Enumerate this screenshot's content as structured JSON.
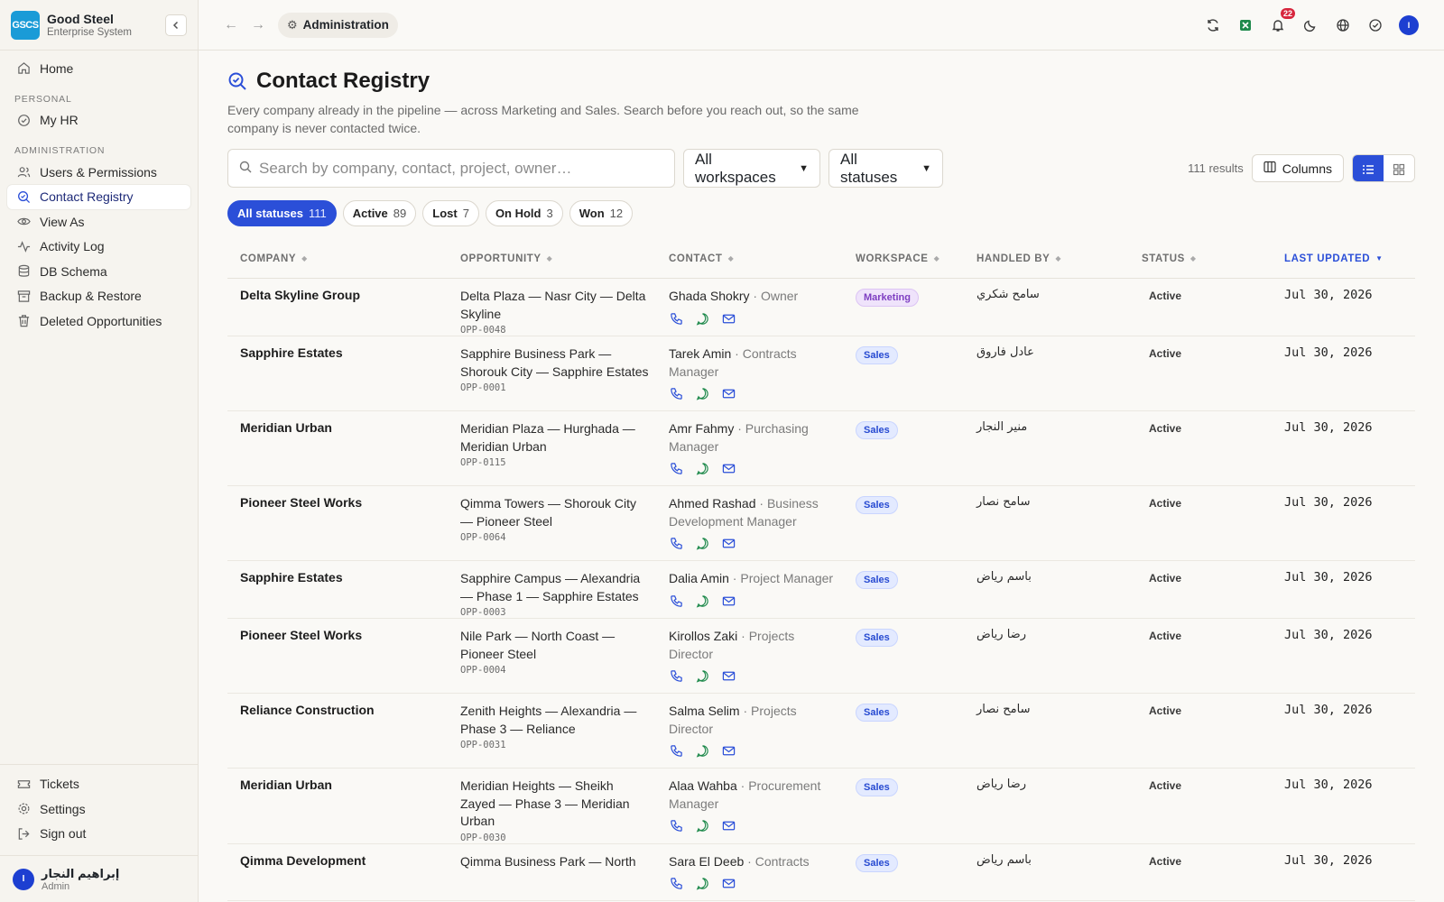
{
  "brand": {
    "logo": "GSCS",
    "name": "Good Steel",
    "subtitle": "Enterprise System",
    "collapse_icon": "chevron-left-icon"
  },
  "sidebar": {
    "home": "Home",
    "section_personal": "PERSONAL",
    "my_hr": "My HR",
    "section_admin": "ADMINISTRATION",
    "items": [
      "Users & Permissions",
      "Contact Registry",
      "View As",
      "Activity Log",
      "DB Schema",
      "Backup & Restore",
      "Deleted Opportunities"
    ],
    "bottom": [
      "Tickets",
      "Settings",
      "Sign out"
    ],
    "user": {
      "initials": "I",
      "name": "إبراهيم النجار",
      "role": "Admin"
    }
  },
  "topbar": {
    "breadcrumb": "Administration",
    "notifications": "22",
    "avatar": "I"
  },
  "page": {
    "title": "Contact Registry",
    "description": "Every company already in the pipeline — across Marketing and Sales. Search before you reach out, so the same company is never contacted twice."
  },
  "filters": {
    "search_placeholder": "Search by company, contact, project, owner…",
    "workspace": "All workspaces",
    "status": "All statuses",
    "results": "111 results",
    "columns_label": "Columns"
  },
  "chips": [
    {
      "label": "All statuses",
      "count": "111"
    },
    {
      "label": "Active",
      "count": "89"
    },
    {
      "label": "Lost",
      "count": "7"
    },
    {
      "label": "On Hold",
      "count": "3"
    },
    {
      "label": "Won",
      "count": "12"
    }
  ],
  "table": {
    "headers": [
      "COMPANY",
      "OPPORTUNITY",
      "CONTACT",
      "WORKSPACE",
      "HANDLED BY",
      "STATUS",
      "LAST UPDATED"
    ],
    "rows": [
      {
        "company": "Delta Skyline Group",
        "opp": "Delta Plaza — Nasr City — Delta Skyline",
        "code": "OPP-0048",
        "contact": "Ghada Shokry",
        "role": "Owner",
        "workspace": "Marketing",
        "handler": "سامح شكري",
        "status": "Active",
        "updated": "Jul 30, 2026"
      },
      {
        "company": "Sapphire Estates",
        "opp": "Sapphire Business Park — Shorouk City — Sapphire Estates",
        "code": "OPP-0001",
        "contact": "Tarek Amin",
        "role": "Contracts Manager",
        "workspace": "Sales",
        "handler": "عادل فاروق",
        "status": "Active",
        "updated": "Jul 30, 2026"
      },
      {
        "company": "Meridian Urban",
        "opp": "Meridian Plaza — Hurghada — Meridian Urban",
        "code": "OPP-0115",
        "contact": "Amr Fahmy",
        "role": "Purchasing Manager",
        "workspace": "Sales",
        "handler": "منير النجار",
        "status": "Active",
        "updated": "Jul 30, 2026"
      },
      {
        "company": "Pioneer Steel Works",
        "opp": "Qimma Towers — Shorouk City — Pioneer Steel",
        "code": "OPP-0064",
        "contact": "Ahmed Rashad",
        "role": "Business Development Manager",
        "workspace": "Sales",
        "handler": "سامح نصار",
        "status": "Active",
        "updated": "Jul 30, 2026"
      },
      {
        "company": "Sapphire Estates",
        "opp": "Sapphire Campus — Alexandria — Phase 1 — Sapphire Estates",
        "code": "OPP-0003",
        "contact": "Dalia Amin",
        "role": "Project Manager",
        "workspace": "Sales",
        "handler": "باسم رياض",
        "status": "Active",
        "updated": "Jul 30, 2026"
      },
      {
        "company": "Pioneer Steel Works",
        "opp": "Nile Park — North Coast — Pioneer Steel",
        "code": "OPP-0004",
        "contact": "Kirollos Zaki",
        "role": "Projects Director",
        "workspace": "Sales",
        "handler": "رضا رياض",
        "status": "Active",
        "updated": "Jul 30, 2026"
      },
      {
        "company": "Reliance Construction",
        "opp": "Zenith Heights — Alexandria — Phase 3 — Reliance",
        "code": "OPP-0031",
        "contact": "Salma Selim",
        "role": "Projects Director",
        "workspace": "Sales",
        "handler": "سامح نصار",
        "status": "Active",
        "updated": "Jul 30, 2026"
      },
      {
        "company": "Meridian Urban",
        "opp": "Meridian Heights — Sheikh Zayed — Phase 3 — Meridian Urban",
        "code": "OPP-0030",
        "contact": "Alaa Wahba",
        "role": "Procurement Manager",
        "workspace": "Sales",
        "handler": "رضا رياض",
        "status": "Active",
        "updated": "Jul 30, 2026"
      },
      {
        "company": "Qimma Development",
        "opp": "Qimma Business Park — North",
        "code": "",
        "contact": "Sara El Deeb",
        "role": "Contracts",
        "workspace": "Sales",
        "handler": "باسم رياض",
        "status": "Active",
        "updated": "Jul 30, 2026"
      }
    ]
  },
  "colors": {
    "accent": "#2b4fd8",
    "sales": "#274ad1",
    "marketing": "#7e3fc2",
    "notification": "#d7263d"
  }
}
